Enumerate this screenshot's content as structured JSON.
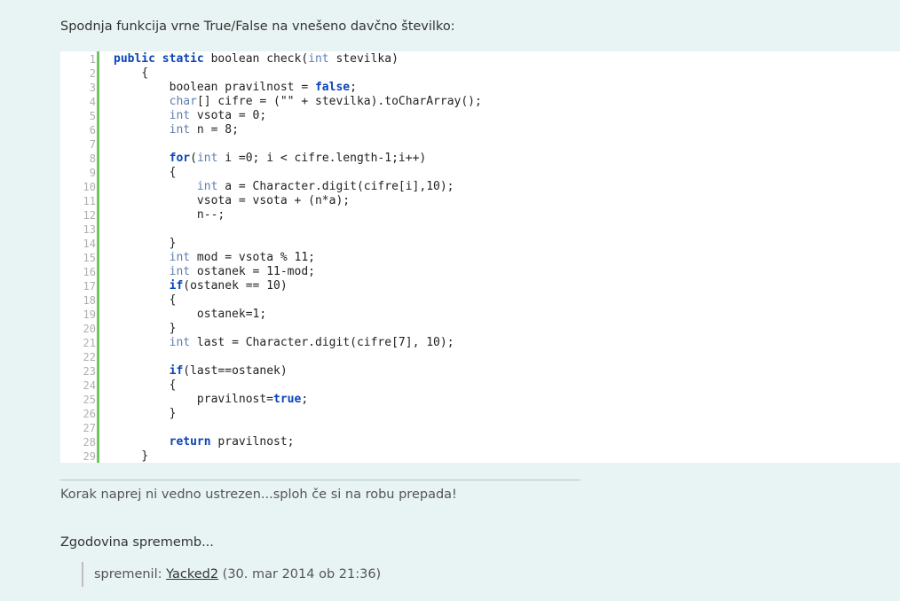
{
  "post": {
    "intro": "Spodnja funkcija vrne True/False na vnešeno davčno številko:"
  },
  "code": {
    "line_numbers": [
      "1",
      "2",
      "3",
      "4",
      "5",
      "6",
      "7",
      "8",
      "9",
      "10",
      "11",
      "12",
      "13",
      "14",
      "15",
      "16",
      "17",
      "18",
      "19",
      "20",
      "21",
      "22",
      "23",
      "24",
      "25",
      "26",
      "27",
      "28",
      "29"
    ],
    "lines": [
      [
        {
          "t": "kw",
          "v": "public static"
        },
        {
          "t": "p",
          "v": " boolean check("
        },
        {
          "t": "kt",
          "v": "int"
        },
        {
          "t": "p",
          "v": " stevilka)"
        }
      ],
      [
        {
          "t": "p",
          "v": "    {"
        }
      ],
      [
        {
          "t": "p",
          "v": "        boolean pravilnost = "
        },
        {
          "t": "kw",
          "v": "false"
        },
        {
          "t": "p",
          "v": ";"
        }
      ],
      [
        {
          "t": "p",
          "v": "        "
        },
        {
          "t": "kt",
          "v": "char"
        },
        {
          "t": "p",
          "v": "[] cifre = (\"\" + stevilka).toCharArray();"
        }
      ],
      [
        {
          "t": "p",
          "v": "        "
        },
        {
          "t": "kt",
          "v": "int"
        },
        {
          "t": "p",
          "v": " vsota = 0;"
        }
      ],
      [
        {
          "t": "p",
          "v": "        "
        },
        {
          "t": "kt",
          "v": "int"
        },
        {
          "t": "p",
          "v": " n = 8;"
        }
      ],
      [
        {
          "t": "p",
          "v": ""
        }
      ],
      [
        {
          "t": "p",
          "v": "        "
        },
        {
          "t": "kw",
          "v": "for"
        },
        {
          "t": "p",
          "v": "("
        },
        {
          "t": "kt",
          "v": "int"
        },
        {
          "t": "p",
          "v": " i =0; i < cifre.length-1;i++)"
        }
      ],
      [
        {
          "t": "p",
          "v": "        {"
        }
      ],
      [
        {
          "t": "p",
          "v": "            "
        },
        {
          "t": "kt",
          "v": "int"
        },
        {
          "t": "p",
          "v": " a = Character.digit(cifre[i],10);"
        }
      ],
      [
        {
          "t": "p",
          "v": "            vsota = vsota + (n*a);"
        }
      ],
      [
        {
          "t": "p",
          "v": "            n--;"
        }
      ],
      [
        {
          "t": "p",
          "v": ""
        }
      ],
      [
        {
          "t": "p",
          "v": "        }"
        }
      ],
      [
        {
          "t": "p",
          "v": "        "
        },
        {
          "t": "kt",
          "v": "int"
        },
        {
          "t": "p",
          "v": " mod = vsota % 11;"
        }
      ],
      [
        {
          "t": "p",
          "v": "        "
        },
        {
          "t": "kt",
          "v": "int"
        },
        {
          "t": "p",
          "v": " ostanek = 11-mod;"
        }
      ],
      [
        {
          "t": "p",
          "v": "        "
        },
        {
          "t": "kw",
          "v": "if"
        },
        {
          "t": "p",
          "v": "(ostanek == 10)"
        }
      ],
      [
        {
          "t": "p",
          "v": "        {"
        }
      ],
      [
        {
          "t": "p",
          "v": "            ostanek=1;"
        }
      ],
      [
        {
          "t": "p",
          "v": "        }"
        }
      ],
      [
        {
          "t": "p",
          "v": "        "
        },
        {
          "t": "kt",
          "v": "int"
        },
        {
          "t": "p",
          "v": " last = Character.digit(cifre[7], 10);"
        }
      ],
      [
        {
          "t": "p",
          "v": ""
        }
      ],
      [
        {
          "t": "p",
          "v": "        "
        },
        {
          "t": "kw",
          "v": "if"
        },
        {
          "t": "p",
          "v": "(last==ostanek)"
        }
      ],
      [
        {
          "t": "p",
          "v": "        {"
        }
      ],
      [
        {
          "t": "p",
          "v": "            pravilnost="
        },
        {
          "t": "kw",
          "v": "true"
        },
        {
          "t": "p",
          "v": ";"
        }
      ],
      [
        {
          "t": "p",
          "v": "        }"
        }
      ],
      [
        {
          "t": "p",
          "v": ""
        }
      ],
      [
        {
          "t": "p",
          "v": "        "
        },
        {
          "t": "kw",
          "v": "return"
        },
        {
          "t": "p",
          "v": " pravilnost;"
        }
      ],
      [
        {
          "t": "p",
          "v": "    }"
        }
      ]
    ]
  },
  "signature": "Korak naprej ni vedno ustrezen...sploh če si na robu prepada!",
  "history": {
    "title": "Zgodovina sprememb...",
    "entry_prefix": "spremenil: ",
    "user": "Yacked2",
    "entry_suffix": " (30. mar 2014 ob 21:36)"
  },
  "colors": {
    "background": "#e8f4f3",
    "code_background": "#ffffff",
    "gutter_bar": "#6ec45e",
    "keyword": "#0a44b8",
    "type": "#5d7fb0"
  }
}
